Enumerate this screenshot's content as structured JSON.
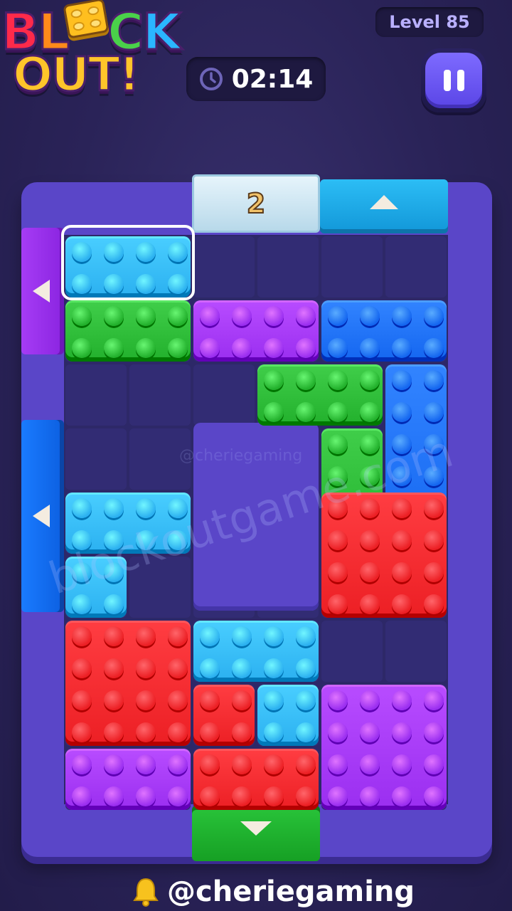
{
  "logo": {
    "line1_letters": [
      "B",
      "L",
      "O",
      "C",
      "K"
    ],
    "line2": "OUT!"
  },
  "header": {
    "level_label": "Level 85",
    "timer": "02:14"
  },
  "board": {
    "ice_block_counter": "2",
    "exits": [
      {
        "side": "left",
        "color": "#a63cf5",
        "arrow": "left"
      },
      {
        "side": "left",
        "color": "#1a7bff",
        "arrow": "left"
      },
      {
        "side": "top",
        "color": "#2cbdf5",
        "arrow": "up"
      },
      {
        "side": "bottom",
        "color": "#29c43a",
        "arrow": "down"
      }
    ],
    "colors": {
      "cyan": "#2bb0f0",
      "blue": "#1466f0",
      "green": "#22b02c",
      "purple": "#9a2ef0",
      "red": "#ec1f24"
    }
  },
  "watermark": "blockoutgame.com",
  "watermark_small": "@cheriegaming",
  "footer": {
    "handle": "@cheriegaming"
  }
}
